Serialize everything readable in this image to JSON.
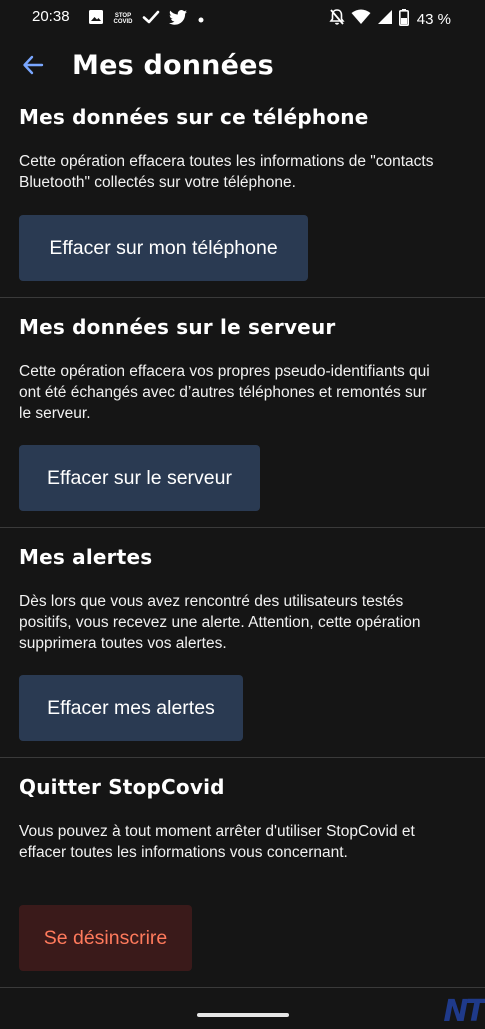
{
  "status_bar": {
    "time": "20:38",
    "battery": "43 %",
    "left_icons": [
      "image-icon",
      "stopcovid-icon",
      "check-icon",
      "twitter-icon",
      "dot-icon"
    ],
    "right_icons": [
      "bell-off-icon",
      "wifi-icon",
      "signal-icon",
      "battery-icon"
    ]
  },
  "app_bar": {
    "title": "Mes données",
    "back_icon": "arrow-left-icon"
  },
  "sections": [
    {
      "title": "Mes données sur ce téléphone",
      "description": "Cette opération effacera toutes les informations de \"contacts Bluetooth\" collectés sur votre téléphone.",
      "button": "Effacer sur mon téléphone"
    },
    {
      "title": "Mes données sur le serveur",
      "description": "Cette opération effacera vos propres pseudo-identifiants qui ont été échangés avec d’autres téléphones et remontés sur le serveur.",
      "button": "Effacer sur le serveur"
    },
    {
      "title": "Mes alertes",
      "description": "Dès lors que vous avez rencontré des utilisateurs testés positifs, vous recevez une alerte. Attention, cette opération supprimera toutes vos alertes.",
      "button": "Effacer mes alertes"
    },
    {
      "title": "Quitter StopCovid",
      "description": "Vous pouvez à tout moment arrêter d'utiliser StopCovid et effacer toutes les informations vous concernant.",
      "button": "Se désinscrire"
    }
  ],
  "colors": {
    "background": "#151515",
    "button": "#2a3a52",
    "danger_button": "#3a1a1a",
    "danger_text": "#ff7a5c",
    "accent": "#7aa7ff"
  }
}
